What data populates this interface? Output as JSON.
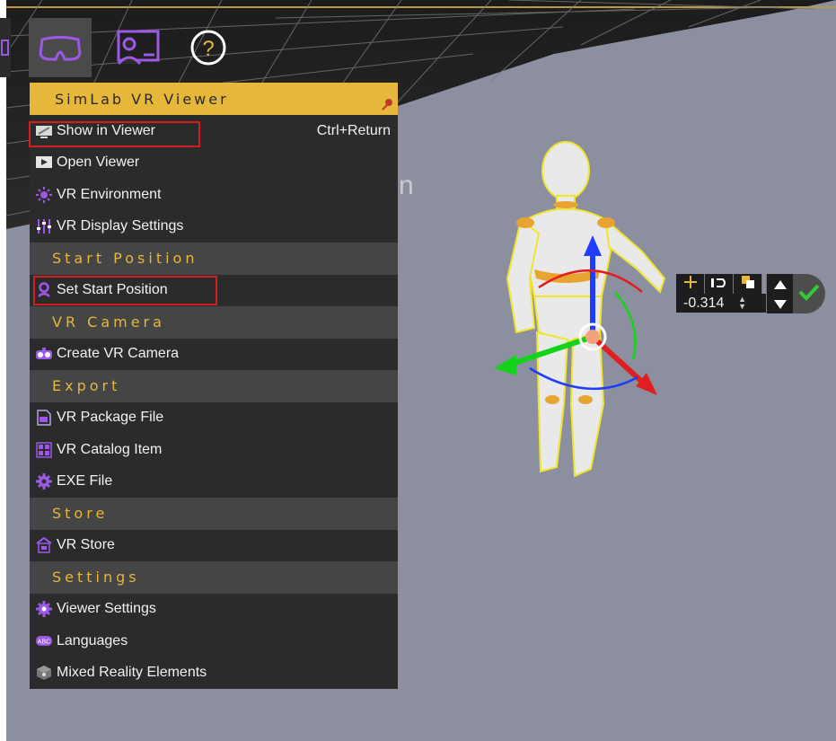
{
  "toolbar": {
    "buttons": [
      {
        "name": "vr-headset-icon",
        "active": true
      },
      {
        "name": "presenter-icon",
        "active": false
      },
      {
        "name": "help-icon",
        "active": false
      }
    ]
  },
  "menu": {
    "title": "SimLab VR Viewer",
    "items": [
      {
        "label": "Show in Viewer",
        "shortcut": "Ctrl+Return",
        "icon": "monitor-icon"
      },
      {
        "label": "Open Viewer",
        "icon": "open-viewer-icon"
      },
      {
        "label": "VR Environment",
        "icon": "sun-icon"
      },
      {
        "label": "VR Display Settings",
        "icon": "sliders-icon"
      }
    ],
    "sections": {
      "start_position": "Start Position",
      "vr_camera": "VR Camera",
      "export": "Export",
      "store": "Store",
      "settings": "Settings"
    },
    "start_position_items": [
      {
        "label": "Set Start Position",
        "icon": "location-pin-icon"
      }
    ],
    "vr_camera_items": [
      {
        "label": "Create VR Camera",
        "icon": "vr-camera-icon"
      }
    ],
    "export_items": [
      {
        "label": "VR Package File",
        "icon": "vr-package-icon"
      },
      {
        "label": "VR Catalog Item",
        "icon": "catalog-icon"
      },
      {
        "label": "EXE File",
        "icon": "exe-gear-icon"
      }
    ],
    "store_items": [
      {
        "label": "VR Store",
        "icon": "store-icon"
      }
    ],
    "settings_items": [
      {
        "label": "Viewer Settings",
        "icon": "gear-icon"
      },
      {
        "label": "Languages",
        "icon": "abc-icon"
      },
      {
        "label": "Mixed Reality Elements",
        "icon": "cube-icon"
      }
    ]
  },
  "scene": {
    "partial_text": "n",
    "transform_value": "-0.314"
  },
  "colors": {
    "accent": "#e6b73a",
    "menu_bg": "#2b2b2b",
    "section_bg": "#454545",
    "icon_purple": "#9b59e6",
    "highlight_red": "#d11f1f",
    "viewport_bg": "#8b8f9f"
  }
}
